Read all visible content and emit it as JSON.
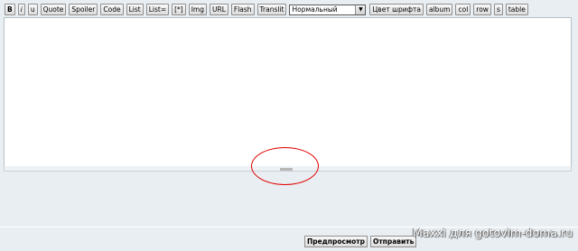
{
  "toolbar": {
    "buttons": [
      "B",
      "i",
      "u",
      "Quote",
      "Spoiler",
      "Code",
      "List",
      "List=",
      "[*]",
      "Img",
      "URL",
      "Flash",
      "Translit"
    ],
    "font_size_select": "Нормальный",
    "buttons2": [
      "Цвет шрифта",
      "album",
      "col",
      "row",
      "s",
      "table"
    ]
  },
  "editor": {
    "content": ""
  },
  "actions": {
    "preview": "Предпросмотр",
    "submit": "Отправить"
  },
  "annotation": {
    "color": "#e00000"
  },
  "watermark": "Maxxi для gotovim-doma.ru"
}
